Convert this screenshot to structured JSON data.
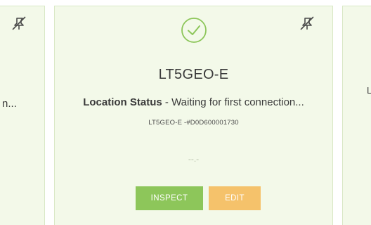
{
  "colors": {
    "card_bg": "#f3f9e9",
    "card_border": "#d9e8c6",
    "check_green": "#8dc65a",
    "inspect_button": "#8dc65a",
    "edit_button": "#f5c26b",
    "pin_icon": "#4a4a4a"
  },
  "cards": {
    "left": {
      "status_truncated": "n...",
      "icon": "pin-off-icon"
    },
    "main": {
      "status_icon": "check-circle-icon",
      "pin_icon": "pin-off-icon",
      "device_name": "LT5GEO-E",
      "status_label": "Location Status",
      "status_separator": " - ",
      "status_text": "Waiting for first connection...",
      "device_id": "LT5GEO-E -#D0D600001730",
      "value_readout": "--.-",
      "inspect_label": "INSPECT",
      "edit_label": "EDIT"
    },
    "right": {
      "status_truncated": "L"
    }
  }
}
